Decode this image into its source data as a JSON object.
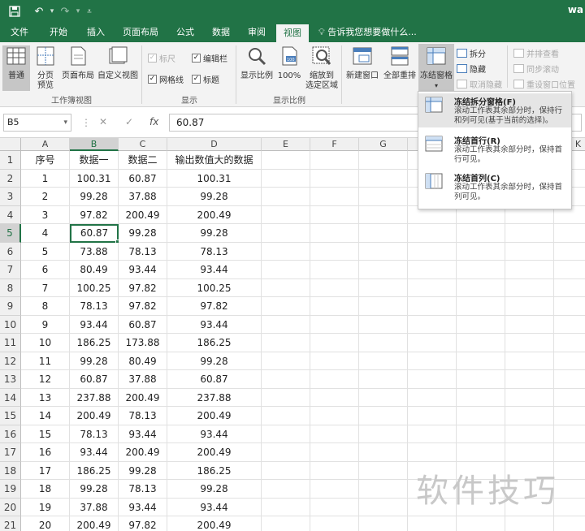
{
  "window": {
    "title_fragment": "wa"
  },
  "quick_access": {
    "save_icon": "save-icon",
    "undo_icon": "undo-icon",
    "redo_icon": "redo-icon",
    "customize_icon": "customize-qat-icon"
  },
  "tabs": [
    {
      "label": "文件",
      "active": false
    },
    {
      "label": "开始",
      "active": false
    },
    {
      "label": "插入",
      "active": false
    },
    {
      "label": "页面布局",
      "active": false
    },
    {
      "label": "公式",
      "active": false
    },
    {
      "label": "数据",
      "active": false
    },
    {
      "label": "审阅",
      "active": false
    },
    {
      "label": "视图",
      "active": true
    }
  ],
  "tell_me": "告诉我您想要做什么...",
  "ribbon": {
    "workbook_views": {
      "label": "工作簿视图",
      "normal": "普通",
      "page_break_l1": "分页",
      "page_break_l2": "预览",
      "page_layout": "页面布局",
      "custom_views": "自定义视图"
    },
    "show": {
      "label": "显示",
      "ruler": "标尺",
      "formula_bar": "编辑栏",
      "gridlines": "网格线",
      "headings": "标题",
      "ruler_checked": true,
      "formula_bar_checked": true,
      "gridlines_checked": true,
      "headings_checked": true
    },
    "zoom": {
      "label": "显示比例",
      "zoom": "显示比例",
      "zoom100": "100%",
      "zoom_sel_l1": "缩放到",
      "zoom_sel_l2": "选定区域"
    },
    "window": {
      "new_window": "新建窗口",
      "arrange_all": "全部重排",
      "freeze_panes": "冻结窗格",
      "split": "拆分",
      "hide": "隐藏",
      "unhide": "取消隐藏",
      "side_by_side": "并排查看",
      "sync_scroll": "同步滚动",
      "reset_position": "重设窗口位置"
    }
  },
  "formula_bar": {
    "name_box": "B5",
    "cancel": "✕",
    "enter": "✓",
    "fx": "fx",
    "value": "60.87"
  },
  "sheet": {
    "columns": [
      "A",
      "B",
      "C",
      "D",
      "E",
      "F",
      "G",
      "H",
      "I",
      "J",
      "K"
    ],
    "selected_column": "B",
    "selected_row": 5,
    "header_row": [
      "序号",
      "数据一",
      "数据二",
      "输出数值大的数据"
    ],
    "rows": [
      [
        "1",
        "100.31",
        "60.87",
        "100.31"
      ],
      [
        "2",
        "99.28",
        "37.88",
        "99.28"
      ],
      [
        "3",
        "97.82",
        "200.49",
        "200.49"
      ],
      [
        "4",
        "60.87",
        "99.28",
        "99.28"
      ],
      [
        "5",
        "73.88",
        "78.13",
        "78.13"
      ],
      [
        "6",
        "80.49",
        "93.44",
        "93.44"
      ],
      [
        "7",
        "100.25",
        "97.82",
        "100.25"
      ],
      [
        "8",
        "78.13",
        "97.82",
        "97.82"
      ],
      [
        "9",
        "93.44",
        "60.87",
        "93.44"
      ],
      [
        "10",
        "186.25",
        "173.88",
        "186.25"
      ],
      [
        "11",
        "99.28",
        "80.49",
        "99.28"
      ],
      [
        "12",
        "60.87",
        "37.88",
        "60.87"
      ],
      [
        "13",
        "237.88",
        "200.49",
        "237.88"
      ],
      [
        "14",
        "200.49",
        "78.13",
        "200.49"
      ],
      [
        "15",
        "78.13",
        "93.44",
        "93.44"
      ],
      [
        "16",
        "93.44",
        "200.49",
        "200.49"
      ],
      [
        "17",
        "186.25",
        "99.28",
        "186.25"
      ],
      [
        "18",
        "99.28",
        "78.13",
        "99.28"
      ],
      [
        "19",
        "37.88",
        "93.44",
        "93.44"
      ],
      [
        "20",
        "200.49",
        "97.82",
        "200.49"
      ]
    ]
  },
  "freeze_menu": {
    "items": [
      {
        "title": "冻结拆分窗格(F)",
        "desc": "滚动工作表其余部分时，保持行和列可见(基于当前的选择)。"
      },
      {
        "title": "冻结首行(R)",
        "desc": "滚动工作表其余部分时，保持首行可见。"
      },
      {
        "title": "冻结首列(C)",
        "desc": "滚动工作表其余部分时，保持首列可见。"
      }
    ]
  },
  "watermark": "软件技巧",
  "colors": {
    "accent": "#217346",
    "ribbon_bg": "#f3f3f3"
  }
}
